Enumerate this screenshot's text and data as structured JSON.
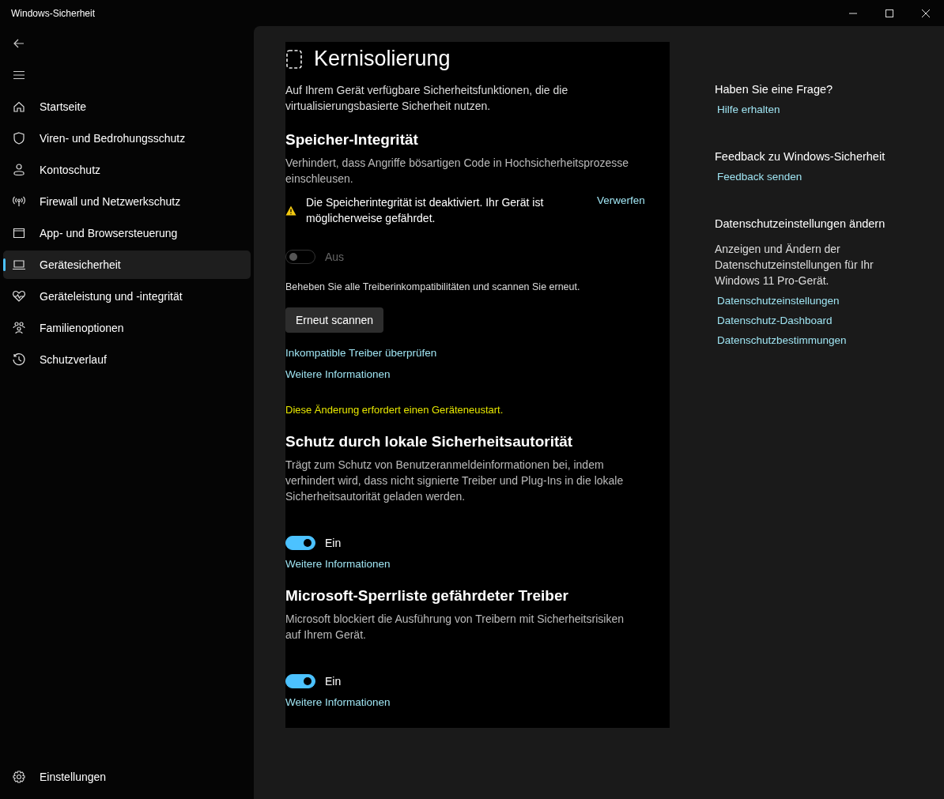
{
  "window": {
    "title": "Windows-Sicherheit"
  },
  "sidebar": {
    "items": [
      {
        "label": "Startseite",
        "selected": false
      },
      {
        "label": "Viren- und Bedrohungsschutz",
        "selected": false
      },
      {
        "label": "Kontoschutz",
        "selected": false
      },
      {
        "label": "Firewall und Netzwerkschutz",
        "selected": false
      },
      {
        "label": "App- und Browsersteuerung",
        "selected": false
      },
      {
        "label": "Gerätesicherheit",
        "selected": true
      },
      {
        "label": "Geräteleistung und -integrität",
        "selected": false
      },
      {
        "label": "Familienoptionen",
        "selected": false
      },
      {
        "label": "Schutzverlauf",
        "selected": false
      }
    ],
    "settings": "Einstellungen"
  },
  "page": {
    "title": "Kernisolierung",
    "intro": "Auf Ihrem Gerät verfügbare Sicherheitsfunktionen, die die virtualisierungsbasierte Sicherheit nutzen."
  },
  "sections": [
    {
      "heading": "Speicher-Integrität",
      "description": "Verhindert, dass Angriffe bösartigen Code in Hochsicherheitsprozesse einschleusen.",
      "warning": {
        "text": "Die Speicherintegrität ist deaktiviert. Ihr Gerät ist möglicherweise gefährdet.",
        "dismiss": "Verwerfen"
      },
      "toggle": {
        "label": "Aus",
        "on": false,
        "disabled": true
      },
      "hint": "Beheben Sie alle Treiberinkompatibilitäten und scannen Sie erneut.",
      "button": "Erneut scannen",
      "links": [
        "Inkompatible Treiber überprüfen",
        "Weitere Informationen"
      ],
      "notice": "Diese Änderung erfordert einen Geräteneustart."
    },
    {
      "heading": "Schutz durch lokale Sicherheitsautorität",
      "description": "Trägt zum Schutz von Benutzeranmeldeinformationen bei, indem verhindert wird, dass nicht signierte Treiber und Plug-Ins in die lokale Sicherheitsautorität geladen werden.",
      "toggle": {
        "label": "Ein",
        "on": true,
        "disabled": false
      },
      "links": [
        "Weitere Informationen"
      ]
    },
    {
      "heading": "Microsoft-Sperrliste gefährdeter Treiber",
      "description": "Microsoft blockiert die Ausführung von Treibern mit Sicherheitsrisiken auf Ihrem Gerät.",
      "toggle": {
        "label": "Ein",
        "on": true,
        "disabled": false
      },
      "links": [
        "Weitere Informationen"
      ]
    }
  ],
  "aside": [
    {
      "heading": "Haben Sie eine Frage?",
      "links": [
        "Hilfe erhalten"
      ]
    },
    {
      "heading": "Feedback zu Windows-Sicherheit",
      "links": [
        "Feedback senden"
      ]
    },
    {
      "heading": "Datenschutzeinstellungen ändern",
      "text": "Anzeigen und Ändern der Datenschutzeinstellungen für Ihr Windows 11 Pro-Gerät.",
      "links": [
        "Datenschutzeinstellungen",
        "Datenschutz-Dashboard",
        "Datenschutzbestimmungen"
      ]
    }
  ]
}
